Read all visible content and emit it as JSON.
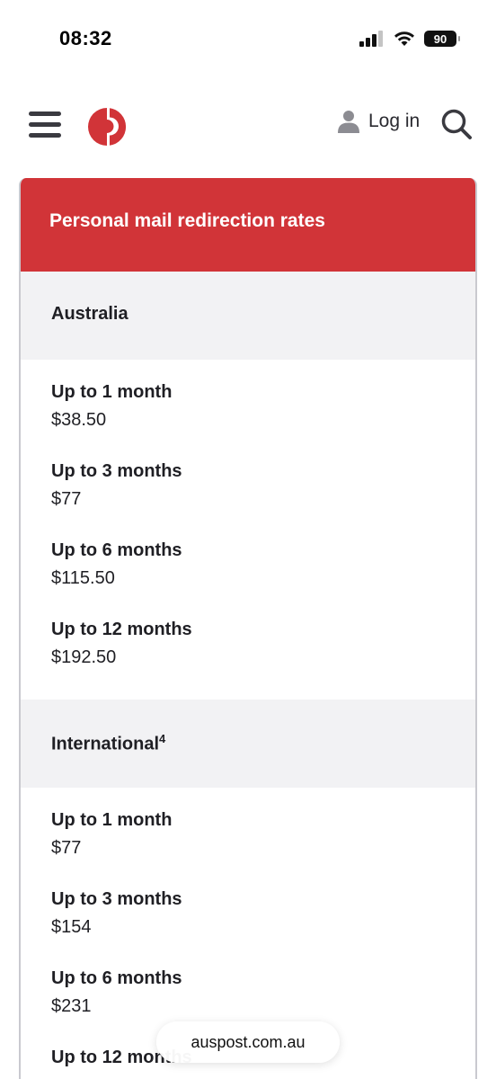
{
  "status": {
    "time": "08:32",
    "battery": "90"
  },
  "header": {
    "login_label": "Log in"
  },
  "card": {
    "title": "Personal mail redirection rates",
    "sections": [
      {
        "heading": "Australia",
        "footnote": "",
        "rates": [
          {
            "label": "Up to 1 month",
            "price": "$38.50"
          },
          {
            "label": "Up to 3 months",
            "price": "$77"
          },
          {
            "label": "Up to 6 months",
            "price": "$115.50"
          },
          {
            "label": "Up to 12 months",
            "price": "$192.50"
          }
        ]
      },
      {
        "heading": "International",
        "footnote": "4",
        "rates": [
          {
            "label": "Up to 1 month",
            "price": "$77"
          },
          {
            "label": "Up to 3 months",
            "price": "$154"
          },
          {
            "label": "Up to 6 months",
            "price": "$231"
          },
          {
            "label": "Up to 12 months",
            "price": ""
          }
        ]
      }
    ]
  },
  "browser": {
    "url": "auspost.com.au"
  },
  "colors": {
    "brand_red": "#d13438",
    "section_bg": "#f2f2f4"
  }
}
